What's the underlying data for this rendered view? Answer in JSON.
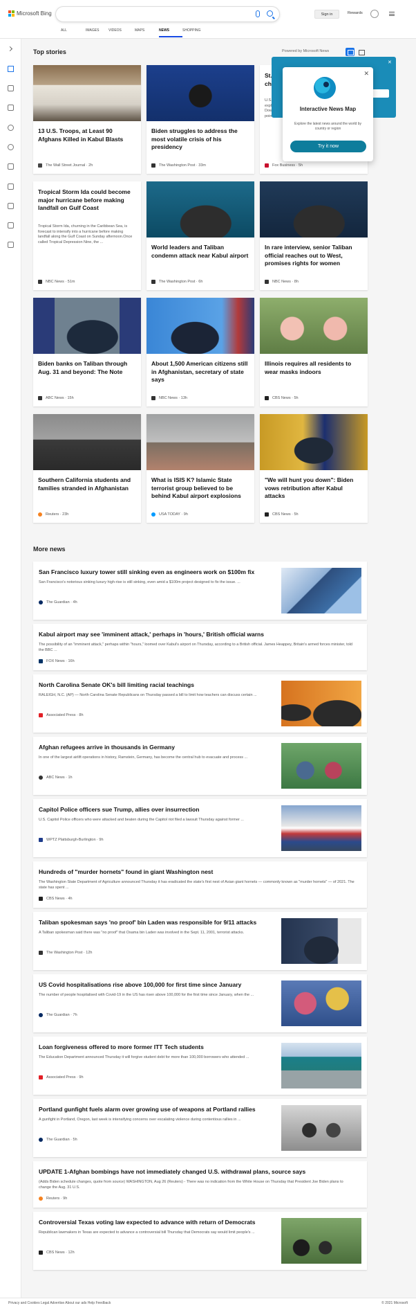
{
  "header": {
    "logo_text": "Microsoft Bing",
    "signin_label": "Sign in",
    "rewards_label": "Rewards"
  },
  "nav": {
    "tabs": [
      {
        "label": "ALL"
      },
      {
        "label": "IMAGES"
      },
      {
        "label": "VIDEOS"
      },
      {
        "label": "MAPS"
      },
      {
        "label": "NEWS",
        "active": true
      },
      {
        "label": "SHOPPING"
      }
    ]
  },
  "top_stories": {
    "title": "Top stories",
    "powered_by": "Powered by Microsoft News",
    "cards": [
      {
        "title": "13 U.S. Troops, at Least 90 Afghans Killed in Kabul Blasts",
        "source": "The Wall Street Journal",
        "age": "2h",
        "icon_color": "#444444"
      },
      {
        "title": "Biden struggles to address the most volatile crisis of his presidency",
        "source": "The Washington Post",
        "age": "33m",
        "icon_color": "#333333"
      },
      {
        "title": "St... ch...",
        "snippet": "U.S. de... explo... Dow J... points...",
        "source": "Fox Business",
        "age": "5h",
        "icon_color": "#c8102e"
      },
      {
        "title": "Tropical Storm Ida could become major hurricane before making landfall on Gulf Coast",
        "snippet": "Tropical Storm Ida, churning in the Caribbean Sea, is forecast to intensify into a hurricane before making landfall along the Gulf Coast on Sunday afternoon.Once called Tropical Depression Nine, the ...",
        "source": "NBC News",
        "age": "51m",
        "icon_color": "#333333"
      },
      {
        "title": "World leaders and Taliban condemn attack near Kabul airport",
        "source": "The Washington Post",
        "age": "6h",
        "icon_color": "#333333"
      },
      {
        "title": "In rare interview, senior Taliban official reaches out to West, promises rights for women",
        "source": "NBC News",
        "age": "8h",
        "icon_color": "#333333"
      },
      {
        "title": "Biden banks on Taliban through Aug. 31 and beyond: The Note",
        "source": "ABC News",
        "age": "15h",
        "icon_color": "#333333"
      },
      {
        "title": "About 1,500 American citizens still in Afghanistan, secretary of state says",
        "source": "NBC News",
        "age": "13h",
        "icon_color": "#333333"
      },
      {
        "title": "Illinois requires all residents to wear masks indoors",
        "source": "CBS News",
        "age": "5h",
        "icon_color": "#222222"
      },
      {
        "title": "Southern California students and families stranded in Afghanistan",
        "source": "Reuters",
        "age": "23h",
        "icon_color": "#f58220"
      },
      {
        "title": "What is ISIS K? Islamic State terrorist group believed to be behind Kabul airport explosions",
        "source": "USA TODAY",
        "age": "9h",
        "icon_color": "#009bff"
      },
      {
        "title": "\"We will hunt you down\": Biden vows retribution after Kabul attacks",
        "source": "CBS News",
        "age": "5h",
        "icon_color": "#222222"
      }
    ]
  },
  "news_map": {
    "title": "Interactive News Map",
    "subtitle": "Explore the latest news around the world by country or region",
    "button_label": "Try it now"
  },
  "more_news": {
    "title": "More news",
    "items": [
      {
        "title": "San Francisco luxury tower still sinking even as engineers work on $100m fix",
        "snippet": "San Francisco's notorious sinking luxury high-rise is still sinking, even amid a $100m project designed to fix the issue. ...",
        "source": "The Guardian",
        "age": "4h",
        "icon_color": "#052962"
      },
      {
        "title": "Kabul airport may see 'imminent attack,' perhaps in 'hours,' British official warns",
        "snippet": "The possibility of an \"imminent attack,\" perhaps within \"hours,\" loomed over Kabul's airport on Thursday, according to a British official. James Heappey, Britain's armed forces minister, told the BBC ...",
        "source": "FOX News",
        "age": "16h",
        "icon_color": "#003366"
      },
      {
        "title": "North Carolina Senate OK's bill limiting racial teachings",
        "snippet": "RALEIGH, N.C. (AP) — North Carolina Senate Republicans on Thursday passed a bill to limit how teachers can discuss certain ...",
        "source": "Associated Press",
        "age": "8h",
        "icon_color": "#e21f26"
      },
      {
        "title": "Afghan refugees arrive in thousands in Germany",
        "snippet": "In one of the largest airlift operations in history, Ramstein, Germany, has become the central hub to evacuate and process ...",
        "source": "ABC News",
        "age": "1h",
        "icon_color": "#333333"
      },
      {
        "title": "Capitol Police officers sue Trump, allies over insurrection",
        "snippet": "U.S. Capitol Police officers who were attacked and beaten during the Capitol riot filed a lawsuit Thursday against former ...",
        "source": "WPTZ Plattsburgh-Burlington",
        "age": "9h",
        "icon_color": "#1e3c8c"
      },
      {
        "title": "Hundreds of \"murder hornets\" found in giant Washington nest",
        "snippet": "The Washington State Department of Agriculture announced Thursday it has eradicated the state's first nest of Asian giant hornets — commonly known as \"murder hornets\" — of 2021. The state has spent ...",
        "source": "CBS News",
        "age": "4h",
        "icon_color": "#222222"
      },
      {
        "title": "Taliban spokesman says 'no proof' bin Laden was responsible for 9/11 attacks",
        "snippet": "A Taliban spokesman said there was \"no proof\" that Osama bin Laden was involved in the Sept. 11, 2001, terrorist attacks.",
        "source": "The Washington Post",
        "age": "12h",
        "icon_color": "#333333"
      },
      {
        "title": "US Covid hospitalisations rise above 100,000 for first time since January",
        "snippet": "The number of people hospitalised with Covid-19 in the US has risen above 100,000 for the first time since January, when the ...",
        "source": "The Guardian",
        "age": "7h",
        "icon_color": "#052962"
      },
      {
        "title": "Loan forgiveness offered to more former ITT Tech students",
        "snippet": "The Education Department announced Thursday it will forgive student debt for more than 100,000 borrowers who attended ...",
        "source": "Associated Press",
        "age": "9h",
        "icon_color": "#e21f26"
      },
      {
        "title": "Portland gunfight fuels alarm over growing use of weapons at Portland rallies",
        "snippet": "A gunfight in Portland, Oregon, last week is intensifying concerns over escalating violence during contentious rallies in ...",
        "source": "The Guardian",
        "age": "5h",
        "icon_color": "#052962"
      },
      {
        "title": "UPDATE 1-Afghan bombings have not immediately changed U.S. withdrawal plans, source says",
        "snippet": "(Adds Biden schedule changes, quote from source) WASHINGTON, Aug 26 (Reuters) - There was no indication from the White House on Thursday that President Joe Biden plans to change the Aug. 31 U.S.",
        "source": "Reuters",
        "age": "9h",
        "icon_color": "#f58220"
      },
      {
        "title": "Controversial Texas voting law expected to advance with return of Democrats",
        "snippet": "Republican lawmakers in Texas are expected to advance a controversial bill Thursday that Democrats say would limit people's ...",
        "source": "CBS News",
        "age": "12h",
        "icon_color": "#222222"
      }
    ]
  },
  "footer": {
    "left_text": "Privacy and Cookies   Legal   Advertise   About our ads   Help   Feedback",
    "right_text": "© 2021 Microsoft"
  }
}
